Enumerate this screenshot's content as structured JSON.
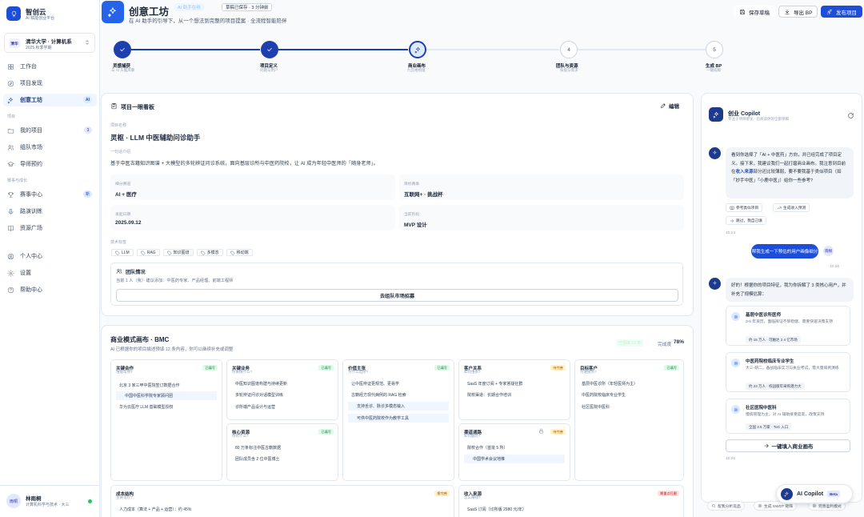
{
  "brand": {
    "name": "智创云",
    "tagline": "AI 赋能创业平台"
  },
  "org": {
    "badge": "清华",
    "name": "清华大学 · 计算机系",
    "term": "2025 秋季学期"
  },
  "nav": {
    "workbench": "工作台",
    "discover": "项目发现",
    "workshop": "创意工坊",
    "workshop_badge": "AI",
    "section_project": "项目",
    "my_projects": "我的项目",
    "my_projects_count": "3",
    "team_market": "组队市场",
    "mentor": "导师预约",
    "section_growth": "赛事与成长",
    "contest": "赛事中心",
    "contest_badge": "新",
    "roadshow": "路演训练",
    "resources": "资源广场",
    "profile": "个人中心",
    "settings": "设置",
    "help": "帮助中心"
  },
  "user": {
    "avatar": "雨桐",
    "name": "林雨桐",
    "desc": "计算机科学与技术 · 大三"
  },
  "header": {
    "title": "创意工坊",
    "ai_badge": "AI 助手在线",
    "saved": "草稿已保存 · 3 分钟前",
    "subtitle": "在 AI 助手的引导下，从一个想法到完整的项目提案 · 全流程智能陪伴",
    "save_btn": "保存草稿",
    "export_btn": "导出 BP",
    "publish_btn": "发布项目"
  },
  "steps": [
    {
      "name": "灵感捕获",
      "sub": "与 AI 头脑风暴",
      "num": "1",
      "state": "done"
    },
    {
      "name": "项目定义",
      "sub": "问题与用户",
      "num": "2",
      "state": "done"
    },
    {
      "name": "商业画布",
      "sub": "九宫格梳理",
      "num": "3",
      "state": "current"
    },
    {
      "name": "团队与资源",
      "sub": "技能与需求",
      "num": "4",
      "state": "todo"
    },
    {
      "name": "生成 BP",
      "sub": "一键成稿",
      "num": "5",
      "state": "todo"
    }
  ],
  "overview": {
    "title": "项目一眼看板",
    "edit": "编辑",
    "name_label": "项目名称",
    "name": "灵枢 · LLM 中医辅助问诊助手",
    "pitch_label": "一句话介绍",
    "pitch": "基于中医古籍知识图谱 + 大模型的多轮辨证问诊系统，面向基层诊所与中医药院校，让 AI 成为年轻中医师的「随身老师」。",
    "fields": [
      {
        "label": "细分赛道",
        "value": "AI + 医疗"
      },
      {
        "label": "目标赛事",
        "value": "互联网+ · 挑战杯"
      },
      {
        "label": "发起日期",
        "value": "2025.09.12"
      },
      {
        "label": "当前阶段",
        "value": "MVP 设计"
      }
    ],
    "tags_label": "技术标签",
    "tags": [
      "LLM",
      "RAG",
      "知识图谱",
      "多模态",
      "移动端"
    ],
    "team_title": "团队情况",
    "team_desc": "当前 1 人（我）· 建议添加：中医药专家、产品经理、前端工程师",
    "team_btn": "去组队市场招募"
  },
  "bmc": {
    "title": "商业模式画布 · BMC",
    "subtitle": "AI 已根据你的项目描述预填 12 条内容，你可以继续补充或调整",
    "ai_filled": "已预填 12 条",
    "completion_label": "完成度",
    "completion": "78%",
    "partners": {
      "title": "关键合作",
      "q": "谁能帮你?",
      "badge": "已填写",
      "items": [
        "北京 3 家三甲中医院签订数据合作",
        "中国中医科学院专家顾问团",
        "华为云医疗 LLM 基础模型授权"
      ]
    },
    "activities": {
      "title": "关键业务",
      "q": "你要做什么?",
      "badge": "已填写",
      "items": [
        "中医知识图谱构建与持续更新",
        "多轮辨证问诊对话模型训练",
        "诊所端产品设计与运营"
      ]
    },
    "value": {
      "title": "价值主张",
      "q": "为什么选你?",
      "badge": "已填写",
      "items": [
        "让中医辨证更规范、更易学",
        "古籍经方现代病例的 RAG 检索",
        "支持舌诊、脉诊多模态输入",
        "可供中医药院校作为教学工具"
      ]
    },
    "relations": {
      "title": "客户关系",
      "q": "如何维系?",
      "badge": "待完善",
      "items": [
        "SaaS 年度订阅 + 专家答疑社群",
        "院校渠道：长期合作培训"
      ]
    },
    "segments": {
      "title": "目标客户",
      "q": "为谁服务?",
      "badge": "已填写",
      "items": [
        "基层中医诊所（年轻医师为主）",
        "中医药院校临床专业学生",
        "社区医院中医科"
      ]
    },
    "resources": {
      "title": "核心资源",
      "q": "你有什么?",
      "badge": "已填写",
      "items": [
        "80 万条标注中医古籍数据",
        "团队成员含 2 位中医博士"
      ]
    },
    "channels": {
      "title": "渠道通路",
      "q": "如何触达?",
      "badge": "待完善",
      "items": [
        "院校合作（首批 5 所）",
        "中国学术会议地推"
      ]
    },
    "costs": {
      "title": "成本结构",
      "q": "主要花在?",
      "badge": "需完善",
      "items": [
        "人力成本（算法 + 产品 + 运营）：约 45%"
      ]
    },
    "revenue": {
      "title": "收入来源",
      "q": "怎么赚钱?",
      "badge": "需重点打磨",
      "items": [
        "SaaS 订阅（诊所版 2980 元/年）"
      ]
    }
  },
  "copilot": {
    "title": "创业 Copilot",
    "sub": "专注于项目孵化 · 已阅读你的全部草稿",
    "msg1_a": "看到你选择了「AI + 中医药」方向，并已经完成了项目定义。接下来，我建议我们一起打磨商业画布。我注意到目前在",
    "msg1_b": "收入来源",
    "msg1_c": "部分还比较薄弱，要不要我基于类似项目（如「妙手中医」「小鹿中医」）给你一些参考?",
    "chip1": "参考类似项目",
    "chip2": "生成收入预测",
    "chip3": "跳过，我自己填",
    "time1": "10:24",
    "user_msg": "帮我生成一下预估的用户画像细分",
    "user_avatar": "雨桐",
    "time2": "10:26",
    "msg2": "好的！根据你的项目特征，我为你拆解了 3 类核心用户，并补充了规模估算：",
    "segs": [
      {
        "title": "基层中医诊所医师",
        "desc": "3-5 年资历，面临辨证不够稳健、需要快速决策支持",
        "badge": "约 15 万人 · 可触达 2.4 亿市场"
      },
      {
        "title": "中医药院校临床专业学生",
        "desc": "大三-研二，备战临床实习与执业考试，需大量病例演练",
        "badge": "约 23 万人 · 校园版年采购潜力大"
      },
      {
        "title": "社区医院中医科",
        "desc": "慢病管理为主，对 AI 辅助接受度高，政策支持",
        "badge": "全国 3.5 万家 · ToG 入口"
      }
    ],
    "fill_btn": "一键填入商业画布",
    "time3": "10:26",
    "suggest": [
      "帮我分析竞品",
      "生成 SWOT 矩阵",
      "完善盈利模式"
    ],
    "fab": "AI Copilot",
    "beta": "Beta"
  },
  "colors": {
    "primary": "#1d4ed8",
    "filled": "#15803d",
    "pending": "#b45309",
    "urgent": "#b91c1c"
  }
}
